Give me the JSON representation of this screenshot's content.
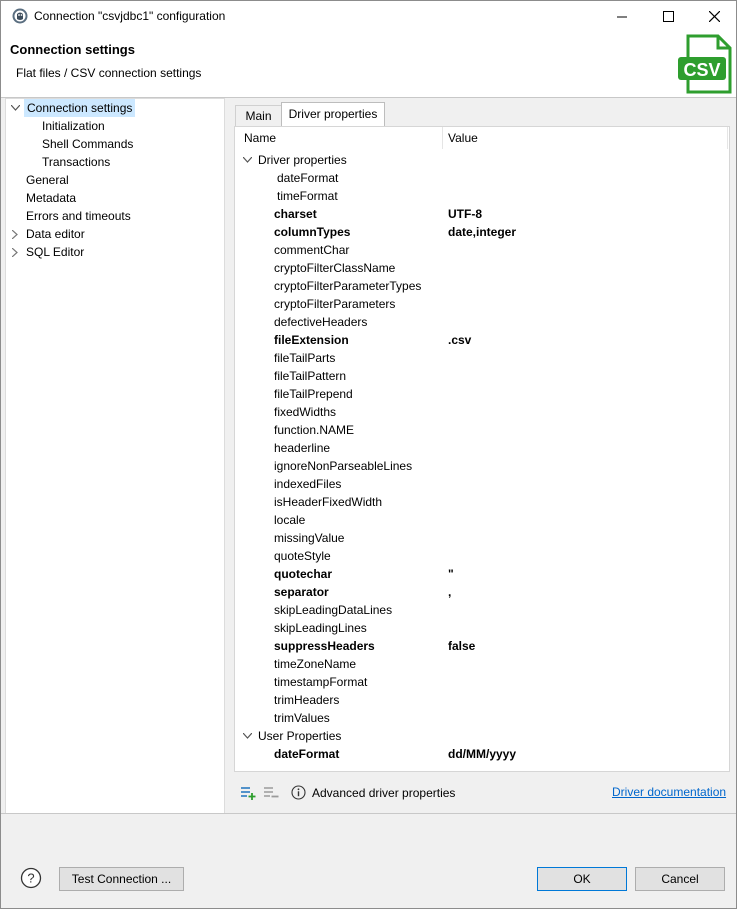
{
  "window": {
    "title": "Connection \"csvjdbc1\" configuration"
  },
  "header": {
    "title": "Connection settings",
    "subtitle": "Flat files / CSV connection settings",
    "logo_text": "CSV",
    "logo_color": "#2e9e2e"
  },
  "nav": {
    "items": [
      {
        "label": "Connection settings",
        "level": 0,
        "expanded": true,
        "selected": true
      },
      {
        "label": "Initialization",
        "level": 1
      },
      {
        "label": "Shell Commands",
        "level": 1
      },
      {
        "label": "Transactions",
        "level": 1
      },
      {
        "label": "General",
        "level": 0
      },
      {
        "label": "Metadata",
        "level": 0
      },
      {
        "label": "Errors and timeouts",
        "level": 0
      },
      {
        "label": "Data editor",
        "level": 0,
        "collapsed": true
      },
      {
        "label": "SQL Editor",
        "level": 0,
        "collapsed": true
      }
    ]
  },
  "tabs": [
    {
      "label": "Main",
      "active": false
    },
    {
      "label": "Driver properties",
      "active": true
    }
  ],
  "table": {
    "headers": {
      "name": "Name",
      "value": "Value"
    },
    "groups": [
      {
        "label": "Driver properties",
        "rows": [
          {
            "name": "dateFormat",
            "value": "",
            "bold": false
          },
          {
            "name": "timeFormat",
            "value": "",
            "bold": false
          },
          {
            "name": "charset",
            "value": "UTF-8",
            "bold": true
          },
          {
            "name": "columnTypes",
            "value": "date,integer",
            "bold": true
          },
          {
            "name": "commentChar",
            "value": "",
            "bold": false
          },
          {
            "name": "cryptoFilterClassName",
            "value": "",
            "bold": false
          },
          {
            "name": "cryptoFilterParameterTypes",
            "value": "",
            "bold": false
          },
          {
            "name": "cryptoFilterParameters",
            "value": "",
            "bold": false
          },
          {
            "name": "defectiveHeaders",
            "value": "",
            "bold": false
          },
          {
            "name": "fileExtension",
            "value": ".csv",
            "bold": true
          },
          {
            "name": "fileTailParts",
            "value": "",
            "bold": false
          },
          {
            "name": "fileTailPattern",
            "value": "",
            "bold": false
          },
          {
            "name": "fileTailPrepend",
            "value": "",
            "bold": false
          },
          {
            "name": "fixedWidths",
            "value": "",
            "bold": false
          },
          {
            "name": "function.NAME",
            "value": "",
            "bold": false
          },
          {
            "name": "headerline",
            "value": "",
            "bold": false
          },
          {
            "name": "ignoreNonParseableLines",
            "value": "",
            "bold": false
          },
          {
            "name": "indexedFiles",
            "value": "",
            "bold": false
          },
          {
            "name": "isHeaderFixedWidth",
            "value": "",
            "bold": false
          },
          {
            "name": "locale",
            "value": "",
            "bold": false
          },
          {
            "name": "missingValue",
            "value": "",
            "bold": false
          },
          {
            "name": "quoteStyle",
            "value": "",
            "bold": false
          },
          {
            "name": "quotechar",
            "value": "\"",
            "bold": true
          },
          {
            "name": "separator",
            "value": ",",
            "bold": true
          },
          {
            "name": "skipLeadingDataLines",
            "value": "",
            "bold": false
          },
          {
            "name": "skipLeadingLines",
            "value": "",
            "bold": false
          },
          {
            "name": "suppressHeaders",
            "value": "false",
            "bold": true
          },
          {
            "name": "timeZoneName",
            "value": "",
            "bold": false
          },
          {
            "name": "timestampFormat",
            "value": "",
            "bold": false
          },
          {
            "name": "trimHeaders",
            "value": "",
            "bold": false
          },
          {
            "name": "trimValues",
            "value": "",
            "bold": false
          }
        ]
      },
      {
        "label": "User Properties",
        "rows": [
          {
            "name": "dateFormat",
            "value": "dd/MM/yyyy",
            "bold": true
          }
        ]
      }
    ]
  },
  "panel_toolbar": {
    "add_icon": "add-property-icon",
    "remove_icon": "remove-property-icon",
    "info_label": "Advanced driver properties",
    "doc_link": "Driver documentation"
  },
  "footer": {
    "help_icon": "help-icon",
    "test_button": "Test Connection ...",
    "ok_button": "OK",
    "cancel_button": "Cancel"
  }
}
